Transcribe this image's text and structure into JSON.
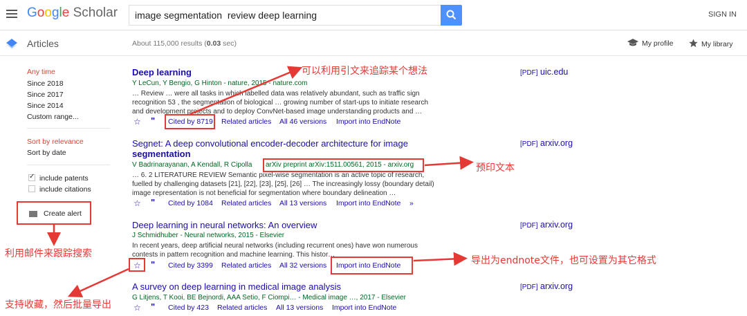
{
  "header": {
    "logo_google": "Google",
    "logo_scholar": "Scholar",
    "search_value": "image segmentation  review deep learning",
    "sign_in": "SIGN IN"
  },
  "subheader": {
    "section": "Articles",
    "stats_prefix": "About 115,000 results (",
    "stats_time": "0.03",
    "stats_suffix": " sec)",
    "my_profile": "My profile",
    "my_library": "My library"
  },
  "sidebar": {
    "time": [
      "Any time",
      "Since 2018",
      "Since 2017",
      "Since 2014",
      "Custom range..."
    ],
    "sort": [
      "Sort by relevance",
      "Sort by date"
    ],
    "include_patents": "include patents",
    "include_citations": "include citations",
    "create_alert": "Create alert"
  },
  "results": [
    {
      "title_parts": [
        "Deep learning"
      ],
      "authors": "Y LeCun, Y Bengio, G Hinton - nature, 2015 - nature.com",
      "snippet": [
        "… Review … were all tasks in which labelled data was relatively abundant, such as traffic sign",
        "recognition 53 , the segmentation of biological … growing number of start-ups to initiate research",
        "and development projects and to deploy ConvNet-based image understanding products and …"
      ],
      "cited_by": "Cited by 8719",
      "related": "Related articles",
      "versions": "All 46 versions",
      "import": "Import into EndNote",
      "pdf_tag": "[PDF]",
      "pdf_source": "uic.edu"
    },
    {
      "title_line1": "Segnet: A deep convolutional encoder-decoder architecture for image",
      "title_line2": "segmentation",
      "authors": "V Badrinarayanan, A Kendall, R Cipolla",
      "preprint": "arXiv preprint arXiv:1511.00561, 2015 - arxiv.org",
      "snippet": [
        "… 6. 2 LITERATURE REVIEW Semantic pixel-wise segmentation is an active topic of research,",
        "fuelled by challenging datasets [21], [22], [23], [25], [26] … The increasingly lossy (boundary detail)",
        "image representation is not beneficial for segmentation where boundary delineation …"
      ],
      "cited_by": "Cited by 1084",
      "related": "Related articles",
      "versions": "All 13 versions",
      "import": "Import into EndNote",
      "more": "»",
      "pdf_tag": "[PDF]",
      "pdf_source": "arxiv.org"
    },
    {
      "title": "Deep learning in neural networks: An overview",
      "authors": "J Schmidhuber - Neural networks, 2015 - Elsevier",
      "snippet": [
        "In recent years, deep artificial neural networks (including recurrent ones) have won numerous",
        "contests in pattern recognition and machine learning. This histor…"
      ],
      "cited_by": "Cited by 3399",
      "related": "Related articles",
      "versions": "All 32 versions",
      "import": "Import into EndNote",
      "pdf_tag": "[PDF]",
      "pdf_source": "arxiv.org"
    },
    {
      "title": "A survey on deep learning in medical image analysis",
      "authors": "G Litjens, T Kooi, BE Bejnordi, AAA Setio, F Ciompi… - Medical image …, 2017 - Elsevier",
      "cited_by": "Cited by 423",
      "related": "Related articles",
      "versions": "All 13 versions",
      "import": "Import into EndNote",
      "pdf_tag": "[PDF]",
      "pdf_source": "arxiv.org"
    }
  ],
  "annotations": {
    "cite_note": "可以利用引文来追踪某个想法",
    "preprint_note": "预印文本",
    "alert_note": "利用邮件来跟踪搜索",
    "endnote_note": "导出为endnote文件，也可设置为其它格式",
    "star_note": "支持收藏，然后批量导出",
    "color": "#e53935"
  },
  "colors": {
    "link": "#1a0dab",
    "green": "#006621",
    "red": "#d14836",
    "accent_blue": "#4d90fe"
  }
}
